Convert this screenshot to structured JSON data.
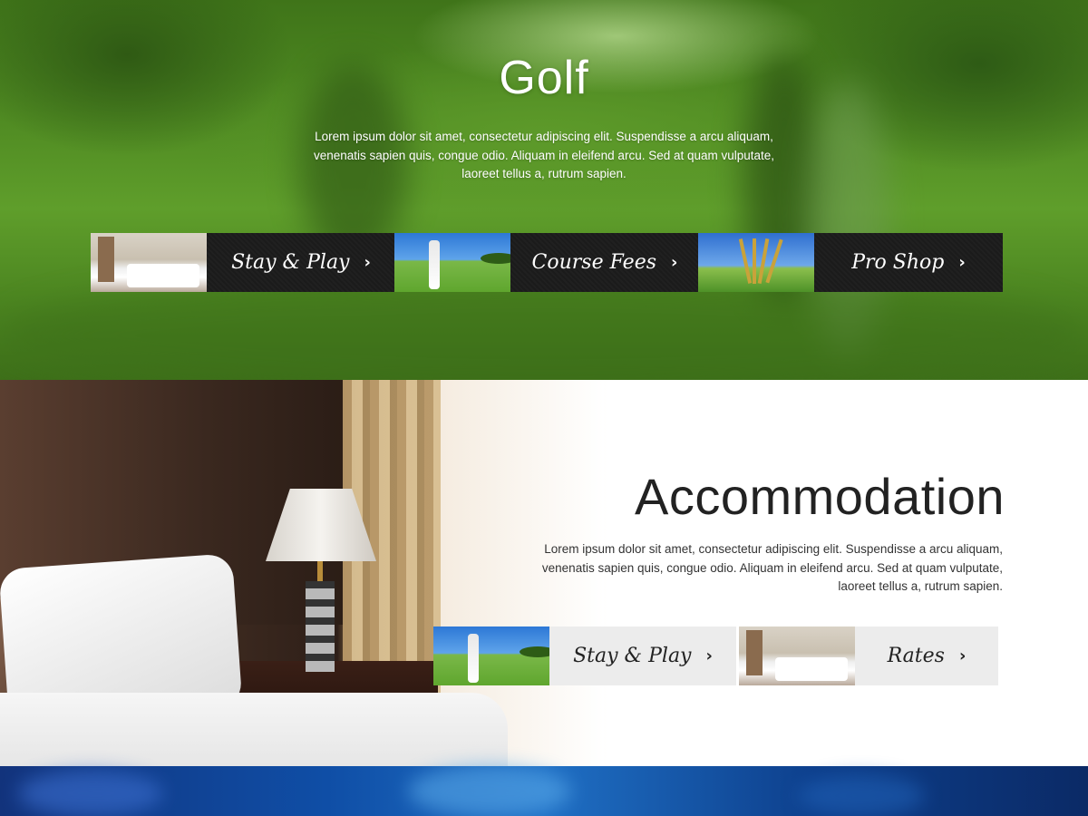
{
  "golf": {
    "title": "Golf",
    "description": "Lorem ipsum dolor sit amet, consectetur adipiscing elit. Suspendisse a arcu aliquam, venenatis sapien quis, congue odio. Aliquam in eleifend arcu. Sed at quam vulputate, laoreet tellus a, rutrum sapien.",
    "links": [
      {
        "label": "Stay & Play",
        "thumb": "hotel-room-photo"
      },
      {
        "label": "Course Fees",
        "thumb": "golfer-swing-photo"
      },
      {
        "label": "Pro Shop",
        "thumb": "golf-clubs-photo"
      }
    ]
  },
  "accommodation": {
    "title": "Accommodation",
    "description": "Lorem ipsum dolor sit amet, consectetur adipiscing elit. Suspendisse a arcu aliquam, venenatis sapien quis, congue odio. Aliquam in eleifend arcu. Sed at quam vulputate, laoreet tellus a, rutrum sapien.",
    "links": [
      {
        "label": "Stay & Play",
        "thumb": "golfer-swing-photo"
      },
      {
        "label": "Rates",
        "thumb": "hotel-room-photo"
      }
    ]
  },
  "icons": {
    "chevron": "›"
  },
  "colors": {
    "tile_dark": "#1c1c1c",
    "tile_light": "#ececec",
    "golf_green": "#4f8a22",
    "footer_blue": "#0f4ea6"
  }
}
